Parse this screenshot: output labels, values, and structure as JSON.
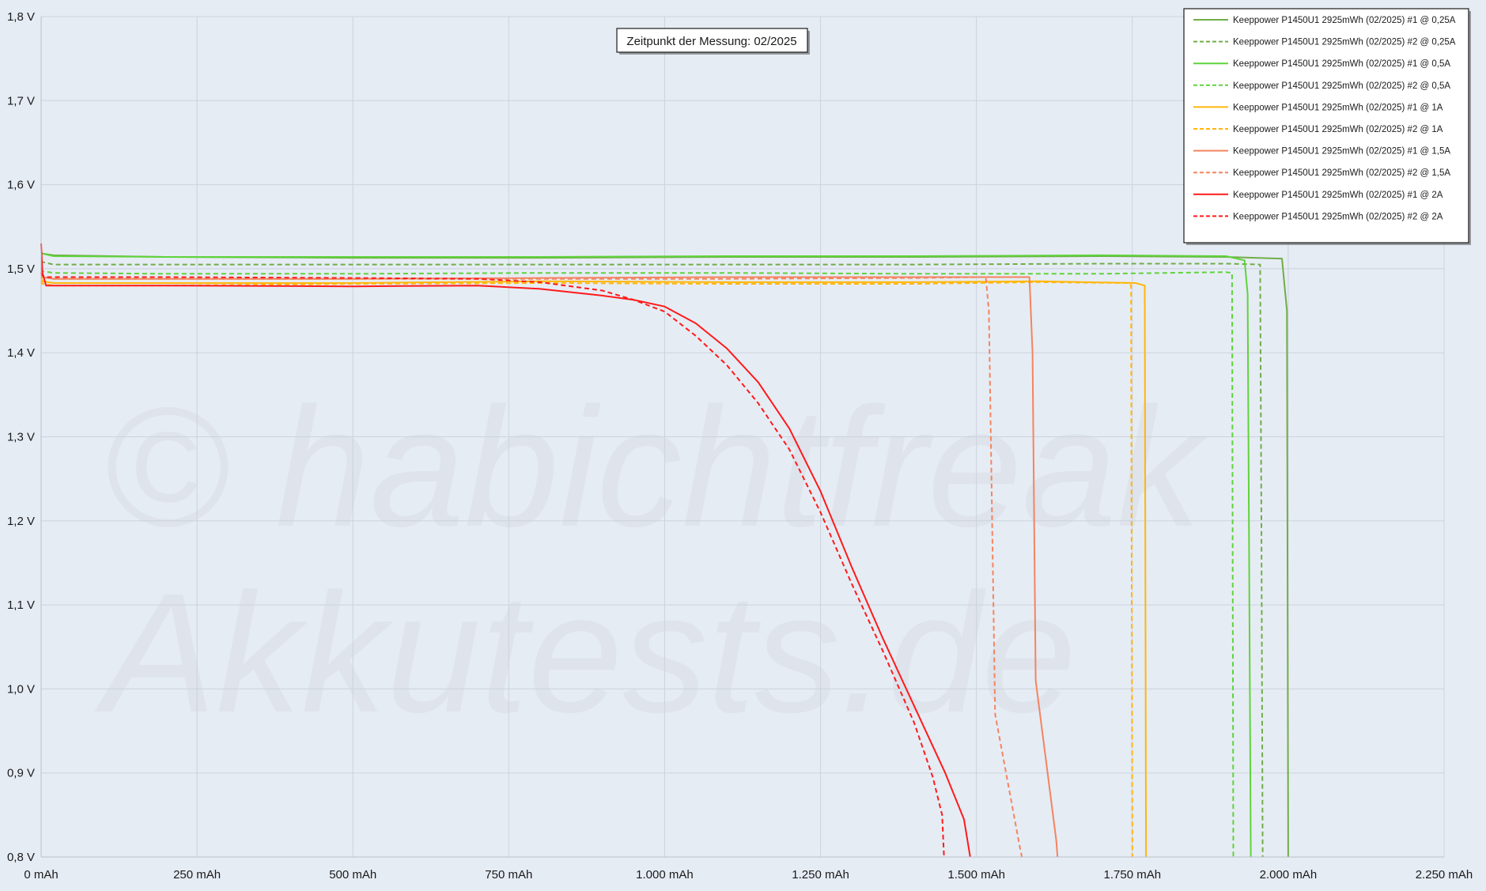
{
  "chart_data": {
    "type": "line",
    "title": "",
    "xlabel": "",
    "ylabel": "",
    "xlim": [
      0,
      2250
    ],
    "ylim": [
      0.8,
      1.8
    ],
    "grid": true,
    "legend_position": "top-right",
    "x_ticks": [
      0,
      250,
      500,
      750,
      1000,
      1250,
      1500,
      1750,
      2000,
      2250
    ],
    "x_tick_labels": [
      "0 mAh",
      "250 mAh",
      "500 mAh",
      "750 mAh",
      "1.000 mAh",
      "1.250 mAh",
      "1.500 mAh",
      "1.750 mAh",
      "2.000 mAh",
      "2.250 mAh"
    ],
    "y_ticks": [
      0.8,
      0.9,
      1.0,
      1.1,
      1.2,
      1.3,
      1.4,
      1.5,
      1.6,
      1.7,
      1.8
    ],
    "y_tick_labels": [
      "0,8 V",
      "0,9 V",
      "1,0 V",
      "1,1 V",
      "1,2 V",
      "1,3 V",
      "1,4 V",
      "1,5 V",
      "1,6 V",
      "1,7 V",
      "1,8 V"
    ],
    "annotation": "Zeitpunkt der Messung: 02/2025",
    "watermark": [
      "© habichtfreak",
      "Akkutests.de"
    ],
    "series": [
      {
        "name": "Keeppower P1450U1 2925mWh (02/2025) #1 @ 0,25A",
        "color": "#70ad47",
        "dash": false,
        "x": [
          0,
          2,
          20,
          200,
          500,
          800,
          1100,
          1400,
          1700,
          1900,
          1990,
          1998,
          2000
        ],
        "y": [
          1.52,
          1.518,
          1.516,
          1.514,
          1.513,
          1.513,
          1.514,
          1.514,
          1.515,
          1.514,
          1.512,
          1.45,
          0.8
        ]
      },
      {
        "name": "Keeppower P1450U1 2925mWh (02/2025) #2 @ 0,25A",
        "color": "#70ad47",
        "dash": true,
        "x": [
          0,
          2,
          20,
          200,
          500,
          800,
          1100,
          1400,
          1700,
          1900,
          1955,
          1957,
          1959
        ],
        "y": [
          1.51,
          1.508,
          1.505,
          1.505,
          1.505,
          1.505,
          1.505,
          1.505,
          1.506,
          1.506,
          1.505,
          1.2,
          0.8
        ]
      },
      {
        "name": "Keeppower P1450U1 2925mWh (02/2025) #1 @ 0,5A",
        "color": "#5fd33b",
        "dash": false,
        "x": [
          0,
          2,
          20,
          200,
          500,
          800,
          1100,
          1400,
          1700,
          1900,
          1930,
          1935,
          1940
        ],
        "y": [
          1.52,
          1.518,
          1.515,
          1.514,
          1.514,
          1.514,
          1.515,
          1.515,
          1.516,
          1.515,
          1.51,
          1.47,
          0.8
        ]
      },
      {
        "name": "Keeppower P1450U1 2925mWh (02/2025) #2 @ 0,5A",
        "color": "#5fd33b",
        "dash": true,
        "x": [
          0,
          2,
          20,
          200,
          500,
          800,
          1100,
          1400,
          1700,
          1900,
          1910,
          1912
        ],
        "y": [
          1.5,
          1.497,
          1.495,
          1.494,
          1.494,
          1.495,
          1.495,
          1.494,
          1.494,
          1.496,
          1.495,
          0.8
        ]
      },
      {
        "name": "Keeppower P1450U1 2925mWh (02/2025) #1 @ 1A",
        "color": "#ffb60a",
        "dash": false,
        "x": [
          0,
          2,
          20,
          200,
          500,
          800,
          1100,
          1400,
          1600,
          1755,
          1770,
          1772
        ],
        "y": [
          1.49,
          1.485,
          1.483,
          1.483,
          1.483,
          1.485,
          1.484,
          1.484,
          1.485,
          1.483,
          1.48,
          0.8
        ]
      },
      {
        "name": "Keeppower P1450U1 2925mWh (02/2025) #2 @ 1A",
        "color": "#ffb60a",
        "dash": true,
        "x": [
          0,
          2,
          20,
          200,
          500,
          800,
          1100,
          1400,
          1600,
          1745,
          1748,
          1750
        ],
        "y": [
          1.485,
          1.482,
          1.48,
          1.48,
          1.482,
          1.483,
          1.482,
          1.482,
          1.484,
          1.483,
          1.48,
          0.8
        ]
      },
      {
        "name": "Keeppower P1450U1 2925mWh (02/2025) #1 @ 1,5A",
        "color": "#f4845f",
        "dash": false,
        "x": [
          0,
          2,
          20,
          200,
          500,
          800,
          1100,
          1400,
          1585,
          1590,
          1595,
          1628,
          1630
        ],
        "y": [
          1.495,
          1.49,
          1.488,
          1.488,
          1.488,
          1.489,
          1.49,
          1.49,
          1.49,
          1.4,
          1.01,
          0.82,
          0.8
        ]
      },
      {
        "name": "Keeppower P1450U1 2925mWh (02/2025) #2 @ 1,5A",
        "color": "#f4845f",
        "dash": true,
        "x": [
          0,
          2,
          20,
          200,
          500,
          800,
          1100,
          1400,
          1515,
          1520,
          1530,
          1570,
          1573
        ],
        "y": [
          1.495,
          1.49,
          1.488,
          1.488,
          1.488,
          1.488,
          1.488,
          1.489,
          1.49,
          1.45,
          0.97,
          0.81,
          0.8
        ]
      },
      {
        "name": "Keeppower P1450U1 2925mWh (02/2025) #1 @ 2A",
        "color": "#ff1a1a",
        "dash": false,
        "x": [
          0,
          2,
          8,
          200,
          500,
          700,
          800,
          900,
          950,
          1000,
          1050,
          1100,
          1150,
          1200,
          1250,
          1300,
          1350,
          1400,
          1450,
          1480,
          1490
        ],
        "y": [
          1.53,
          1.495,
          1.48,
          1.48,
          1.479,
          1.48,
          1.476,
          1.468,
          1.463,
          1.455,
          1.435,
          1.405,
          1.365,
          1.31,
          1.235,
          1.145,
          1.06,
          0.98,
          0.9,
          0.845,
          0.8
        ]
      },
      {
        "name": "Keeppower P1450U1 2925mWh (02/2025) #2 @ 2A",
        "color": "#ff1a1a",
        "dash": true,
        "x": [
          0,
          2,
          8,
          200,
          500,
          700,
          800,
          900,
          950,
          1000,
          1050,
          1100,
          1150,
          1200,
          1250,
          1300,
          1350,
          1400,
          1430,
          1445,
          1448
        ],
        "y": [
          1.495,
          1.492,
          1.49,
          1.49,
          1.489,
          1.488,
          1.484,
          1.474,
          1.463,
          1.449,
          1.42,
          1.385,
          1.34,
          1.285,
          1.21,
          1.125,
          1.045,
          0.96,
          0.895,
          0.85,
          0.8
        ]
      }
    ]
  }
}
